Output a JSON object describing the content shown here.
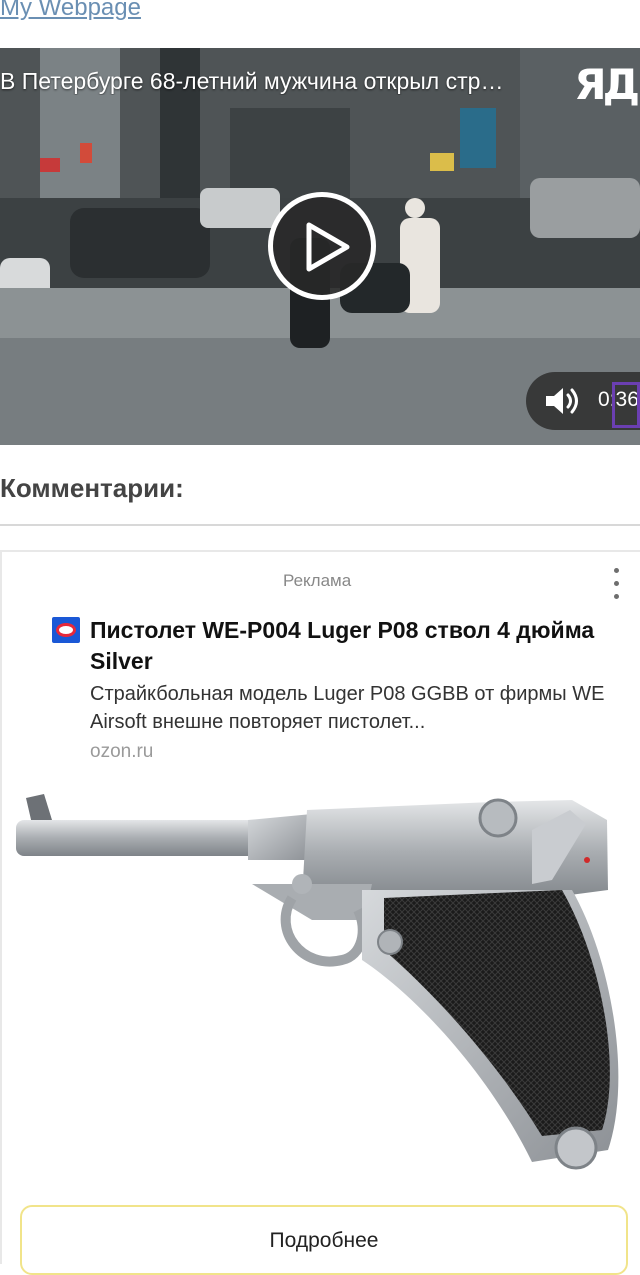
{
  "header": {
    "site_link": "My Webpage"
  },
  "video": {
    "title": "В Петербурге 68-летний мужчина открыл стр…",
    "channel_logo": "ЯД",
    "time": "0:36",
    "play_icon": "play-icon",
    "volume_icon": "volume-icon"
  },
  "comments": {
    "heading": "Комментарии:"
  },
  "ad": {
    "label": "Реклама",
    "menu_icon": "more-vertical-icon",
    "advertiser_icon": "ozon-icon",
    "title": "Пистолет WE-P004 Luger P08 ствол 4 дюйма Silver",
    "description": "Страйкбольная модель Luger P08 GGBB от фирмы WE Airsoft внешне повторяет пистолет...",
    "domain": "ozon.ru",
    "cta_label": "Подробнее"
  },
  "colors": {
    "link": "#6a8fb3",
    "ozon_blue": "#1a58d6",
    "ozon_red": "#e8283a",
    "focus_purple": "#6b3fb2",
    "cta_border": "#f1e48a"
  }
}
